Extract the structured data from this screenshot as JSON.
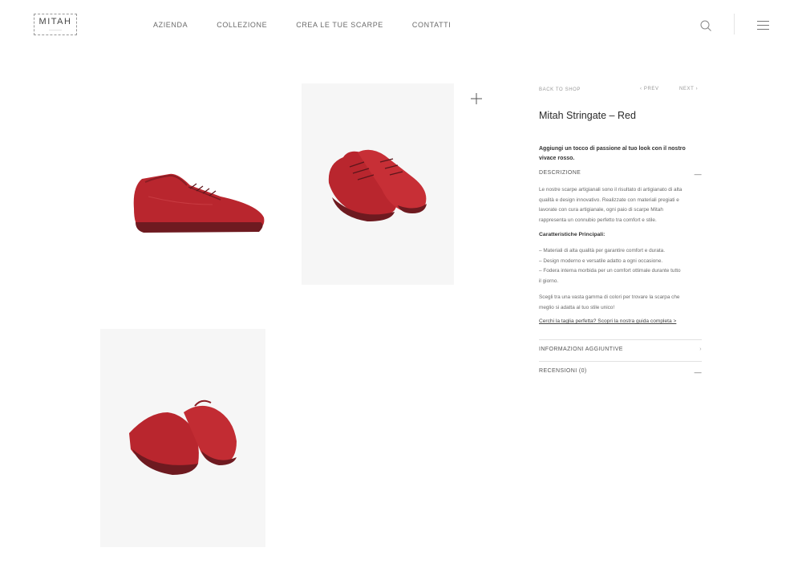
{
  "header": {
    "logo_text": "MITAH",
    "nav": [
      "AZIENDA",
      "COLLEZIONE",
      "CREA LE TUE SCARPE",
      "CONTATTI"
    ],
    "icons": [
      "search-icon",
      "menu-icon"
    ]
  },
  "gallery": {
    "images": [
      "red-sneaker-side-view",
      "red-sneaker-pair-front-view",
      "red-sneaker-pair-back-view"
    ],
    "zoom_icon": "plus-icon"
  },
  "product": {
    "back_label": "BACK TO SHOP",
    "prev_label": "PREV",
    "next_label": "NEXT",
    "title": "Mitah Stringate – Red",
    "lead_line1": "Aggiungi un tocco di passione al tuo look con il nostro",
    "lead_line2": "vivace rosso.",
    "description_label": "DESCRIZIONE",
    "desc_p1_l1": "Le nostre scarpe artigianali sono il risultato di artigianato di alta",
    "desc_p1_l2": "qualità e design innovativo. Realizzate con materiali pregiati e",
    "desc_p1_l3": "lavorate con cura artigianale, ogni paio di scarpe Mitah",
    "desc_p1_l4": "rappresenta un connubio perfetto tra comfort e stile.",
    "features_title": "Caratteristiche Principali:",
    "feature_1": "– Materiali di alta qualità per garantire comfort e durata.",
    "feature_2": "– Design moderno e versatile adatto a ogni occasione.",
    "feature_3_l1": "– Fodera interna morbida per un comfort ottimale durante tutto",
    "feature_3_l2": "il giorno.",
    "desc_p2_l1": "Scegli tra una vasta gamma di colori per trovare la scarpa che",
    "desc_p2_l2": "meglio si adatta al tuo stile unico!",
    "size_guide_link": "Cerchi la taglia perfetta? Scopri la nostra guida completa >",
    "info_label": "INFORMAZIONI AGGIUNTIVE",
    "reviews_label": "RECENSIONI (0)"
  },
  "colors": {
    "shoe_red": "#b9262e",
    "sole_dark": "#6e1a20",
    "text_main": "#2a2a2a",
    "text_muted": "#6a6a6a"
  }
}
